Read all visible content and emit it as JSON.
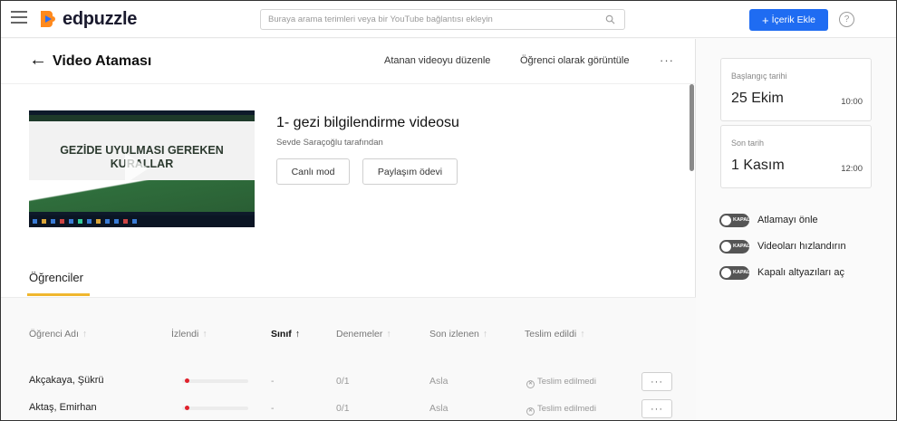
{
  "app": {
    "name": "edpuzzle"
  },
  "search": {
    "placeholder": "Buraya arama terimleri veya bir YouTube bağlantısı ekleyin"
  },
  "header": {
    "add_content_label": "İçerik Ekle",
    "add_content_plus": "+",
    "help_symbol": "?"
  },
  "page": {
    "back_arrow": "←",
    "title": "Video Ataması",
    "edit_link": "Atanan videoyu düzenle",
    "student_view_link": "Öğrenci olarak görüntüle",
    "more": "···"
  },
  "video": {
    "thumbnail_text": "GEZİDE UYULMASI GEREKEN KURALLAR",
    "title": "1- gezi bilgilendirme videosu",
    "author": "Sevde Saraçoğlu tarafından",
    "live_mode_label": "Canlı mod",
    "share_label": "Paylaşım ödevi"
  },
  "tabs": {
    "students": "Öğrenciler"
  },
  "table": {
    "columns": [
      {
        "label": "Öğrenci Adı",
        "arrow": "↑"
      },
      {
        "label": "İzlendi",
        "arrow": "↑"
      },
      {
        "label": "Sınıf",
        "arrow": "↑"
      },
      {
        "label": "Denemeler",
        "arrow": "↑"
      },
      {
        "label": "Son izlenen",
        "arrow": "↑"
      },
      {
        "label": "Teslim edildi",
        "arrow": "↑"
      }
    ],
    "rows": [
      {
        "name": "Akçakaya, Şükrü",
        "watched_fraction": 0.02,
        "grade": "-",
        "attempts": "0/1",
        "last_watched": "Asla",
        "submitted": "Teslim edilmedi",
        "menu": "···"
      },
      {
        "name": "Aktaş, Emirhan",
        "watched_fraction": 0.02,
        "grade": "-",
        "attempts": "0/1",
        "last_watched": "Asla",
        "submitted": "Teslim edilmedi",
        "menu": "···"
      }
    ]
  },
  "sidebar": {
    "start": {
      "label": "Başlangıç tarihi",
      "date": "25 Ekim",
      "time": "10:00"
    },
    "due": {
      "label": "Son tarih",
      "date": "1 Kasım",
      "time": "12:00"
    },
    "toggle_off_text": "KAPALI",
    "toggles": [
      {
        "label": "Atlamayı önle",
        "on": false
      },
      {
        "label": "Videoları hızlandırın",
        "on": false
      },
      {
        "label": "Kapalı altyazıları aç",
        "on": false
      }
    ]
  },
  "colors": {
    "brand_blue": "#1f6cf2",
    "tab_accent": "#f0b72f",
    "progress_red": "#e0212b"
  }
}
